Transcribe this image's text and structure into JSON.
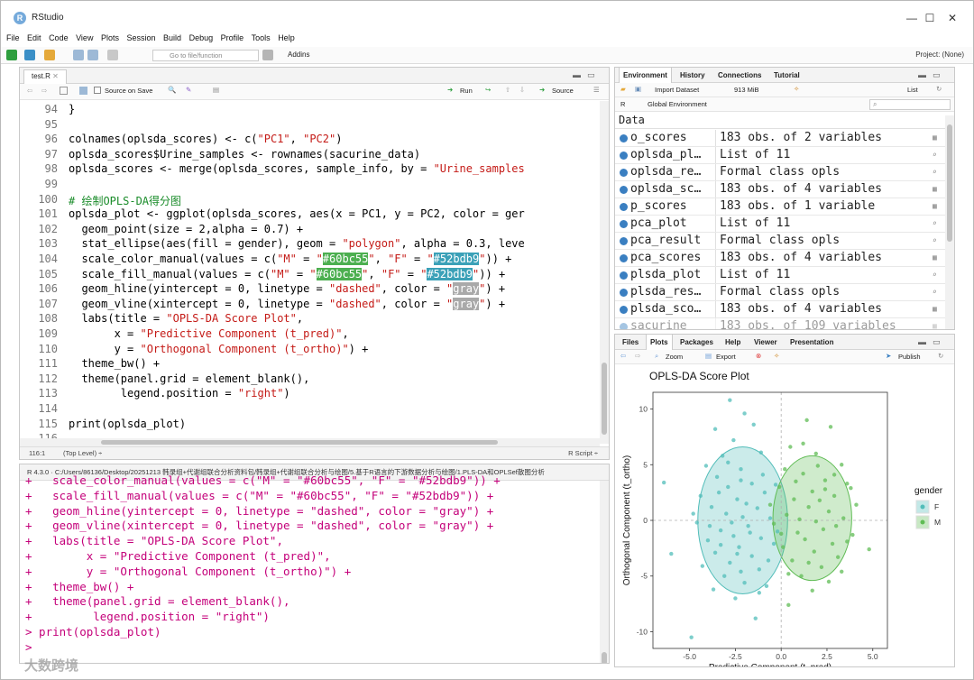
{
  "window": {
    "title": "RStudio",
    "minimize": "—",
    "maximize": "☐",
    "close": "✕"
  },
  "menu": [
    "File",
    "Edit",
    "Code",
    "View",
    "Plots",
    "Session",
    "Build",
    "Debug",
    "Profile",
    "Tools",
    "Help"
  ],
  "toolbar": {
    "goto_placeholder": "Go to file/function",
    "addins": "Addins",
    "project": "Project: (None)"
  },
  "editor": {
    "tab": "test.R",
    "source_on_save": "Source on Save",
    "run": "Run",
    "source": "Source",
    "lines": [
      {
        "n": "94",
        "t": "}"
      },
      {
        "n": "95",
        "t": ""
      },
      {
        "n": "96",
        "t": "colnames(oplsda_scores) <- c(\"PC1\", \"PC2\")"
      },
      {
        "n": "97",
        "t": "oplsda_scores$Urine_samples <- rownames(sacurine_data)"
      },
      {
        "n": "98",
        "t": "oplsda_scores <- merge(oplsda_scores, sample_info, by = \"Urine_samples"
      },
      {
        "n": "99",
        "t": ""
      },
      {
        "n": "100",
        "t": "# 绘制OPLS-DA得分图"
      },
      {
        "n": "101",
        "t": "oplsda_plot <- ggplot(oplsda_scores, aes(x = PC1, y = PC2, color = ger"
      },
      {
        "n": "102",
        "t": "  geom_point(size = 2,alpha = 0.7) +"
      },
      {
        "n": "103",
        "t": "  stat_ellipse(aes(fill = gender), geom = \"polygon\", alpha = 0.3, leve"
      },
      {
        "n": "104",
        "t": "  scale_color_manual(values = c(\"M\" = \"#60bc55\", \"F\" = \"#52bdb9\")) +"
      },
      {
        "n": "105",
        "t": "  scale_fill_manual(values = c(\"M\" = \"#60bc55\", \"F\" = \"#52bdb9\")) +"
      },
      {
        "n": "106",
        "t": "  geom_hline(yintercept = 0, linetype = \"dashed\", color = \"gray\") +"
      },
      {
        "n": "107",
        "t": "  geom_vline(xintercept = 0, linetype = \"dashed\", color = \"gray\") +"
      },
      {
        "n": "108",
        "t": "  labs(title = \"OPLS-DA Score Plot\","
      },
      {
        "n": "109",
        "t": "       x = \"Predictive Component (t_pred)\","
      },
      {
        "n": "110",
        "t": "       y = \"Orthogonal Component (t_ortho)\") +"
      },
      {
        "n": "111",
        "t": "  theme_bw() +"
      },
      {
        "n": "112",
        "t": "  theme(panel.grid = element_blank(),"
      },
      {
        "n": "113",
        "t": "        legend.position = \"right\")"
      },
      {
        "n": "114",
        "t": ""
      },
      {
        "n": "115",
        "t": "print(oplsda_plot)"
      },
      {
        "n": "116",
        "t": ""
      }
    ],
    "status_pos": "116:1",
    "status_scope": "(Top Level) ÷",
    "status_lang": "R Script ÷"
  },
  "console": {
    "header": "R 4.3.0 · C:/Users/86136/Desktop/20251213 韩录组+代谢组联合分析资料包/韩录组+代谢组联合分析与绘图/5.基于R语言的下游数据分析与绘图/1.PLS-DA和OPLSef散图分析",
    "lines": [
      "+   scale_color_manual(values = c(\"M\" = \"#60bc55\", \"F\" = \"#52bdb9\")) +",
      "+   scale_fill_manual(values = c(\"M\" = \"#60bc55\", \"F\" = \"#52bdb9\")) +",
      "+   geom_hline(yintercept = 0, linetype = \"dashed\", color = \"gray\") +",
      "+   geom_vline(xintercept = 0, linetype = \"dashed\", color = \"gray\") +",
      "+   labs(title = \"OPLS-DA Score Plot\",",
      "+        x = \"Predictive Component (t_pred)\",",
      "+        y = \"Orthogonal Component (t_ortho)\") +",
      "+   theme_bw() +",
      "+   theme(panel.grid = element_blank(),",
      "+         legend.position = \"right\")",
      "> print(oplsda_plot)",
      ">"
    ],
    "watermark": "大数跨境"
  },
  "env": {
    "tabs": [
      "Environment",
      "History",
      "Connections",
      "Tutorial"
    ],
    "import": "Import Dataset",
    "memory": "913 MiB",
    "list": "List",
    "lang": "R",
    "scope": "Global Environment",
    "section": "Data",
    "rows": [
      {
        "name": "o_scores",
        "value": "183 obs. of 2 variables",
        "icon": "table-icon"
      },
      {
        "name": "oplsda_pl…",
        "value": "List of  11",
        "icon": "search-icon"
      },
      {
        "name": "oplsda_re…",
        "value": "Formal class  opls",
        "icon": "search-icon"
      },
      {
        "name": "oplsda_sc…",
        "value": "183 obs. of 4 variables",
        "icon": "table-icon"
      },
      {
        "name": "p_scores",
        "value": "183 obs. of 1 variable",
        "icon": "table-icon"
      },
      {
        "name": "pca_plot",
        "value": "List of  11",
        "icon": "search-icon"
      },
      {
        "name": "pca_result",
        "value": "Formal class  opls",
        "icon": "search-icon"
      },
      {
        "name": "pca_scores",
        "value": "183 obs. of 4 variables",
        "icon": "table-icon"
      },
      {
        "name": "plsda_plot",
        "value": "List of  11",
        "icon": "search-icon"
      },
      {
        "name": "plsda_res…",
        "value": "Formal class  opls",
        "icon": "search-icon"
      },
      {
        "name": "plsda_sco…",
        "value": "183 obs. of 4 variables",
        "icon": "table-icon"
      },
      {
        "name": "sacurine",
        "value": "183 obs. of 109 variables",
        "icon": "table-icon"
      }
    ]
  },
  "plots": {
    "tabs": [
      "Files",
      "Plots",
      "Packages",
      "Help",
      "Viewer",
      "Presentation"
    ],
    "zoom": "Zoom",
    "export": "Export",
    "publish": "Publish"
  },
  "chart_data": {
    "type": "scatter",
    "title": "OPLS-DA Score Plot",
    "xlabel": "Predictive Component (t_pred)",
    "ylabel": "Orthogonal Component (t_ortho)",
    "xlim": [
      -7.0,
      5.8
    ],
    "ylim": [
      -11.5,
      11.5
    ],
    "xticks": [
      "-5.0",
      "-2.5",
      "0.0",
      "2.5",
      "5.0"
    ],
    "xtick_values": [
      -5,
      -2.5,
      0,
      2.5,
      5
    ],
    "yticks": [
      "10",
      "5",
      "0",
      "-5",
      "-10"
    ],
    "ytick_values": [
      10,
      5,
      0,
      -5,
      -10
    ],
    "grid": false,
    "legend": {
      "title": "gender",
      "position": "right",
      "entries": [
        "F",
        "M"
      ]
    },
    "colors": {
      "F": "#52bdb9",
      "M": "#60bc55"
    },
    "ellipses": [
      {
        "group": "F",
        "cx": -2.1,
        "cy": 0.0,
        "rx": 2.45,
        "ry": 6.6
      },
      {
        "group": "M",
        "cx": 1.7,
        "cy": 0.2,
        "rx": 2.15,
        "ry": 5.6
      }
    ],
    "series": [
      {
        "name": "F",
        "points": [
          [
            -2.8,
            10.8
          ],
          [
            -2.0,
            9.6
          ],
          [
            -3.6,
            8.2
          ],
          [
            -1.5,
            8.6
          ],
          [
            -2.6,
            7.2
          ],
          [
            -3.2,
            5.8
          ],
          [
            -1.1,
            6.1
          ],
          [
            -4.1,
            4.9
          ],
          [
            -2.2,
            4.6
          ],
          [
            -3.5,
            3.9
          ],
          [
            -1.6,
            3.3
          ],
          [
            -2.9,
            3.0
          ],
          [
            -4.4,
            2.2
          ],
          [
            -0.9,
            2.5
          ],
          [
            -2.4,
            1.9
          ],
          [
            -3.8,
            1.2
          ],
          [
            -1.3,
            1.1
          ],
          [
            -3.0,
            0.6
          ],
          [
            -2.1,
            0.3
          ],
          [
            -4.6,
            -0.2
          ],
          [
            -0.6,
            0.2
          ],
          [
            -1.8,
            -0.5
          ],
          [
            -3.3,
            -0.9
          ],
          [
            -2.6,
            -1.4
          ],
          [
            -1.1,
            -1.6
          ],
          [
            -4.0,
            -1.8
          ],
          [
            -2.3,
            -2.4
          ],
          [
            -0.4,
            -2.1
          ],
          [
            -3.6,
            -2.9
          ],
          [
            -1.6,
            -3.2
          ],
          [
            -2.8,
            -3.8
          ],
          [
            -4.3,
            -4.1
          ],
          [
            -1.2,
            -4.4
          ],
          [
            -3.1,
            -5.0
          ],
          [
            -2.0,
            -5.6
          ],
          [
            -3.7,
            -6.2
          ],
          [
            -0.8,
            -5.9
          ],
          [
            -2.5,
            -7.0
          ],
          [
            -1.4,
            -8.8
          ],
          [
            -4.9,
            -10.5
          ],
          [
            -6.0,
            -3.0
          ],
          [
            -0.2,
            -1.0
          ],
          [
            -2.2,
            3.6
          ],
          [
            -3.9,
            -0.5
          ],
          [
            -1.0,
            4.1
          ],
          [
            -2.7,
            -0.2
          ],
          [
            -3.4,
            2.5
          ],
          [
            -1.9,
            1.5
          ],
          [
            -2.4,
            -3.0
          ],
          [
            -0.3,
            3.2
          ],
          [
            -6.4,
            3.4
          ],
          [
            -1.2,
            -6.5
          ],
          [
            -4.8,
            0.6
          ],
          [
            -2.9,
            5.2
          ],
          [
            -3.3,
            -2.2
          ],
          [
            -0.7,
            -3.6
          ],
          [
            -1.7,
            -1.1
          ],
          [
            -2.2,
            -4.6
          ]
        ]
      },
      {
        "name": "M",
        "points": [
          [
            1.4,
            9.0
          ],
          [
            2.7,
            8.4
          ],
          [
            0.5,
            6.6
          ],
          [
            1.9,
            6.0
          ],
          [
            3.3,
            5.0
          ],
          [
            0.2,
            4.6
          ],
          [
            1.2,
            4.2
          ],
          [
            2.4,
            3.6
          ],
          [
            3.6,
            3.3
          ],
          [
            -0.1,
            3.0
          ],
          [
            1.7,
            2.6
          ],
          [
            2.9,
            2.2
          ],
          [
            0.7,
            1.9
          ],
          [
            4.1,
            1.4
          ],
          [
            1.5,
            1.2
          ],
          [
            2.6,
            0.8
          ],
          [
            0.3,
            0.5
          ],
          [
            3.4,
            0.2
          ],
          [
            1.9,
            -0.1
          ],
          [
            -0.4,
            -0.3
          ],
          [
            2.3,
            -0.8
          ],
          [
            0.9,
            -1.1
          ],
          [
            3.9,
            -1.3
          ],
          [
            1.3,
            -1.7
          ],
          [
            2.8,
            -2.1
          ],
          [
            0.1,
            -2.4
          ],
          [
            1.8,
            -2.8
          ],
          [
            3.1,
            -3.3
          ],
          [
            0.6,
            -3.6
          ],
          [
            2.2,
            -4.2
          ],
          [
            1.1,
            -5.0
          ],
          [
            2.6,
            -5.5
          ],
          [
            1.7,
            -6.3
          ],
          [
            0.4,
            -7.6
          ],
          [
            4.8,
            -2.6
          ],
          [
            3.8,
            2.9
          ],
          [
            -0.6,
            1.4
          ],
          [
            2.0,
            4.9
          ],
          [
            1.0,
            0.1
          ],
          [
            3.0,
            -0.5
          ],
          [
            2.4,
            2.8
          ],
          [
            0.8,
            3.5
          ],
          [
            1.5,
            -3.8
          ],
          [
            3.3,
            -4.6
          ],
          [
            0.0,
            -1.2
          ],
          [
            2.1,
            1.8
          ],
          [
            1.2,
            6.9
          ],
          [
            3.6,
            -1.9
          ],
          [
            0.4,
            -4.8
          ],
          [
            2.9,
            4.1
          ]
        ]
      }
    ]
  }
}
